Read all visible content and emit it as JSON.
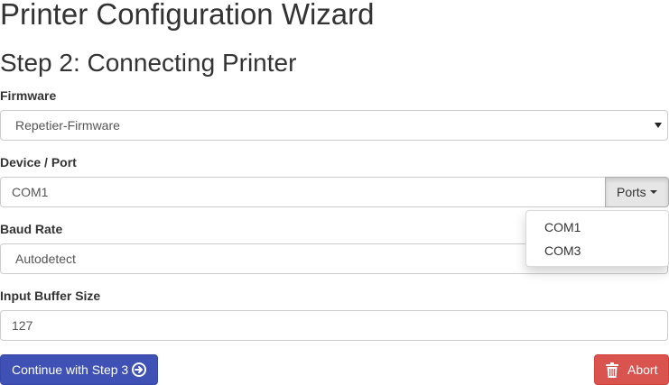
{
  "page": {
    "title": "Printer Configuration Wizard",
    "step_title": "Step 2: Connecting Printer"
  },
  "firmware": {
    "label": "Firmware",
    "selected": "Repetier-Firmware"
  },
  "device_port": {
    "label": "Device / Port",
    "value": "COM1",
    "ports_button": "Ports",
    "dropdown_options": [
      "COM1",
      "COM3"
    ]
  },
  "baud_rate": {
    "label": "Baud Rate",
    "selected": "Autodetect"
  },
  "input_buffer": {
    "label": "Input Buffer Size",
    "value": "127"
  },
  "buttons": {
    "continue_label": "Continue with Step 3",
    "abort_label": "Abort"
  },
  "colors": {
    "primary": "#3f51b5",
    "danger": "#d9534f"
  },
  "icons": {
    "continue": "arrow-circle-right-icon",
    "abort": "trash-icon"
  }
}
